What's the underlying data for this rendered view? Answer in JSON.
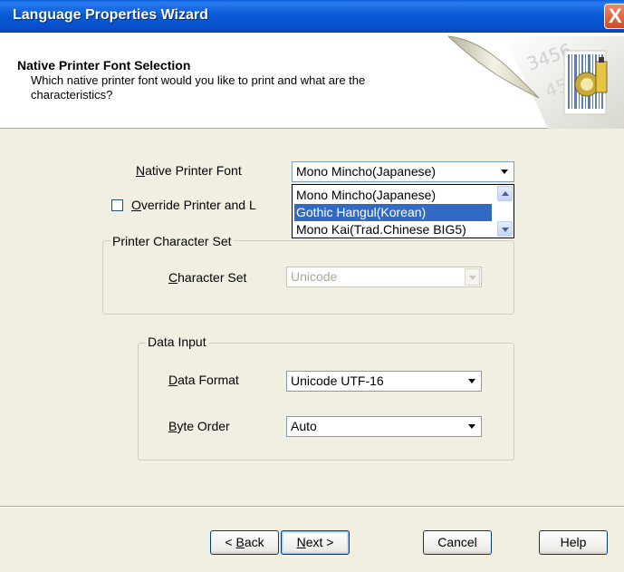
{
  "window": {
    "title": "Language Properties Wizard",
    "close_label": "X"
  },
  "header": {
    "title": "Native Printer Font Selection",
    "subtitle": "Which native printer font would you like to print and what are the characteristics?"
  },
  "native_font": {
    "label_u": "N",
    "label_rest": "ative Printer Font",
    "value": "Mono Mincho(Japanese)",
    "options": [
      "Mono Mincho(Japanese)",
      "Gothic Hangul(Korean)",
      "Mono Kai(Trad.Chinese BIG5)"
    ],
    "highlighted": "Gothic Hangul(Korean)"
  },
  "override": {
    "label_u": "O",
    "label_rest": "verride Printer and L",
    "checked": false
  },
  "printer_charset": {
    "legend": "Printer Character Set",
    "label_u": "C",
    "label_rest": "haracter Set",
    "value": "Unicode"
  },
  "data_input": {
    "legend": "Data Input",
    "format_label_u": "D",
    "format_label_rest": "ata Format",
    "format_value": "Unicode UTF-16",
    "order_label_u": "B",
    "order_label_rest": "yte Order",
    "order_value": "Auto"
  },
  "buttons": {
    "back_prefix": "< ",
    "back_u": "B",
    "back_rest": "ack",
    "next_u": "N",
    "next_rest": "ext >",
    "cancel": "Cancel",
    "help": "Help"
  },
  "colors": {
    "titlebar": "#0a5ad6",
    "selection": "#316ac5",
    "dialog_bg": "#f1efe2"
  }
}
